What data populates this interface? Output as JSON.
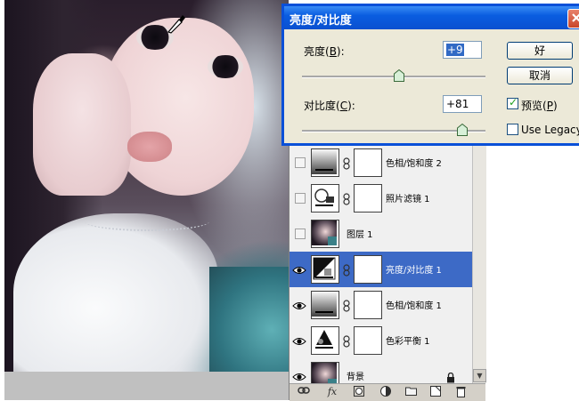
{
  "dialog": {
    "title": "亮度/对比度",
    "brightness_label": "亮度(",
    "brightness_key": "B",
    "brightness_suffix": "):",
    "brightness_value": "+9",
    "brightness_level": 9,
    "contrast_label": "对比度(",
    "contrast_key": "C",
    "contrast_suffix": "):",
    "contrast_value": "+81",
    "contrast_level": 81,
    "ok_label": "好",
    "cancel_label": "取消",
    "preview_label": "预览(",
    "preview_key": "P",
    "preview_suffix": ")",
    "preview_checked": true,
    "legacy_label": "Use Legacy",
    "legacy_checked": false
  },
  "layers": [
    {
      "name": "色相/饱和度 2",
      "visible": false,
      "selected": false,
      "thumb": "hue-saturation-icon"
    },
    {
      "name": "照片滤镜 1",
      "visible": false,
      "selected": false,
      "thumb": "photo-filter-icon"
    },
    {
      "name": "图层 1",
      "visible": false,
      "selected": false,
      "thumb": "photo-thumb"
    },
    {
      "name": "亮度/对比度 1",
      "visible": true,
      "selected": true,
      "thumb": "brightness-contrast-icon"
    },
    {
      "name": "色相/饱和度 1",
      "visible": true,
      "selected": false,
      "thumb": "hue-saturation-icon"
    },
    {
      "name": "色彩平衡 1",
      "visible": true,
      "selected": false,
      "thumb": "color-balance-icon"
    },
    {
      "name": "背景",
      "visible": true,
      "selected": false,
      "thumb": "photo-thumb",
      "locked": true
    }
  ],
  "footer_icons": [
    "link-icon",
    "fx-icon",
    "mask-icon",
    "adjustment-icon",
    "folder-icon",
    "new-layer-icon",
    "trash-icon"
  ],
  "footer_labels": {
    "fx": "fx"
  },
  "colors": {
    "selected_row": "#3d6ac6",
    "title_bar": "#0a50d0"
  }
}
